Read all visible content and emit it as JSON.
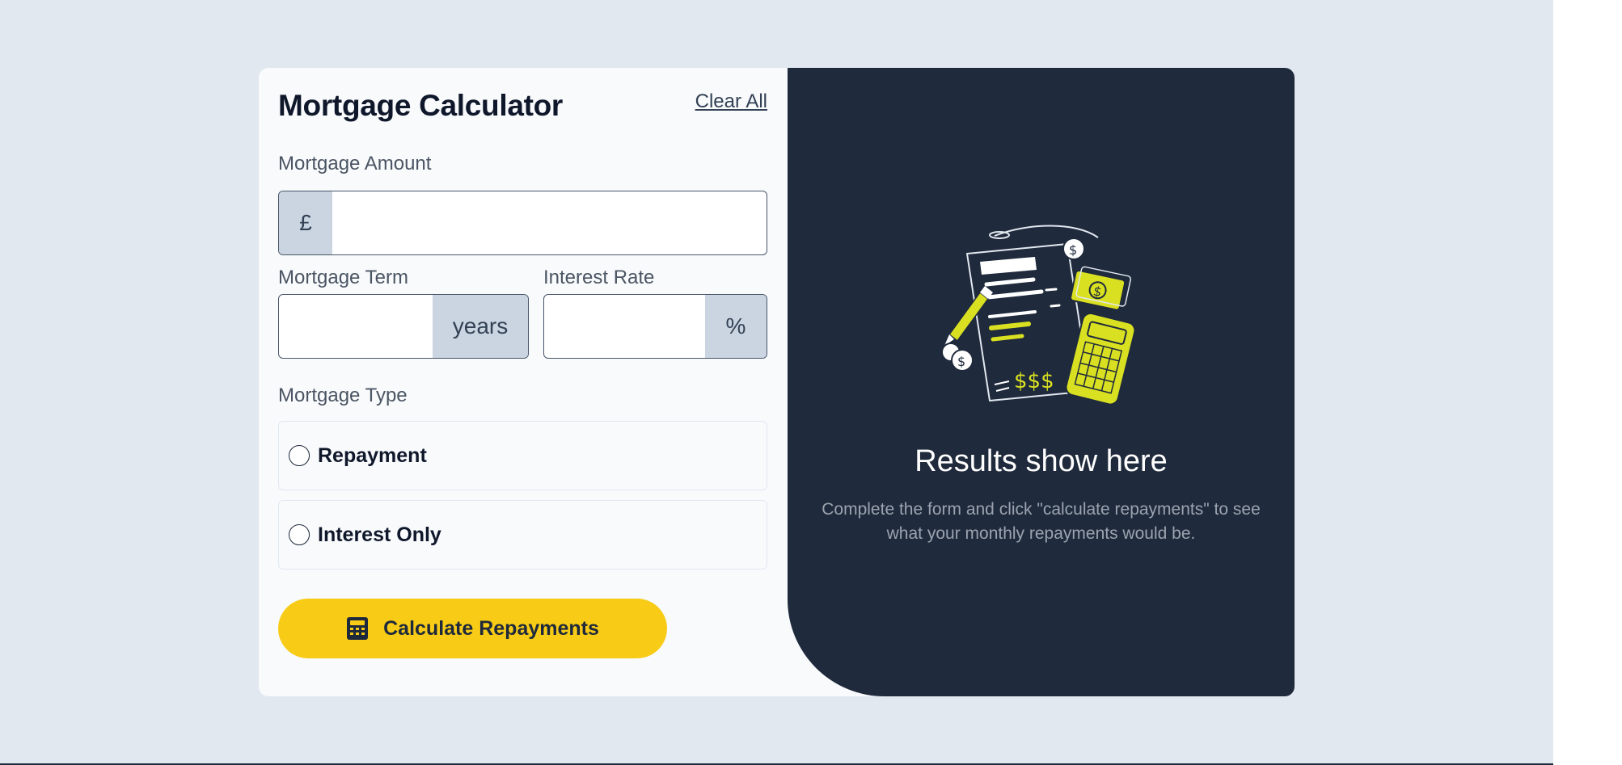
{
  "form": {
    "title": "Mortgage Calculator",
    "clear_all": "Clear All",
    "amount": {
      "label": "Mortgage Amount",
      "prefix": "£",
      "value": ""
    },
    "term": {
      "label": "Mortgage Term",
      "suffix": "years",
      "value": ""
    },
    "rate": {
      "label": "Interest Rate",
      "suffix": "%",
      "value": ""
    },
    "type": {
      "label": "Mortgage Type",
      "options": [
        {
          "label": "Repayment",
          "selected": false
        },
        {
          "label": "Interest Only",
          "selected": false
        }
      ]
    },
    "calculate": {
      "label": "Calculate Repayments",
      "icon": "calculator-icon"
    }
  },
  "results": {
    "heading": "Results show here",
    "description": "Complete the form and click \"calculate repayments\" to see what your monthly repayments would be.",
    "illustration": "empty-results-illustration"
  },
  "colors": {
    "page_bg": "#e2e8f0",
    "card_bg": "#f8fafc",
    "panel_bg": "#1f2a3c",
    "accent": "#f8cc16",
    "addon_bg": "#cbd5e1"
  }
}
